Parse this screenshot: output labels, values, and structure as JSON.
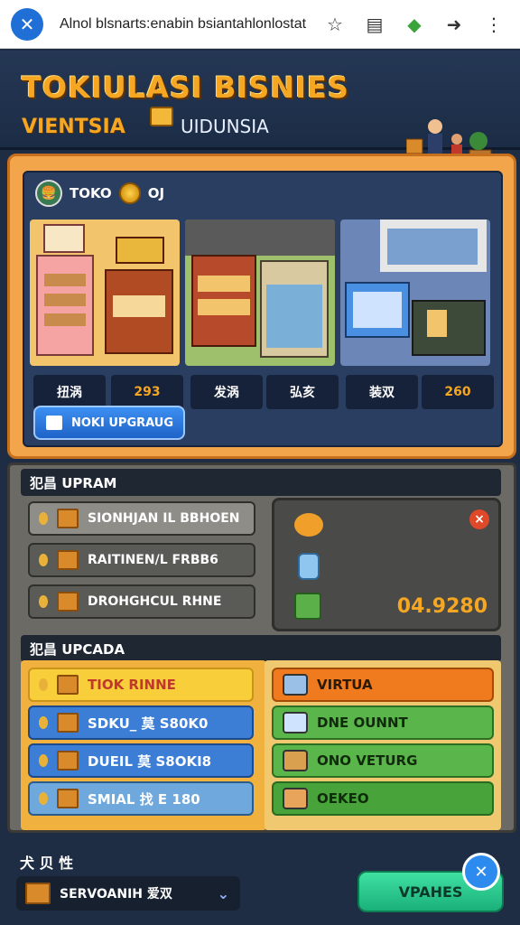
{
  "browser": {
    "url": "Alnol blsnarts:enabin bsiantahlonlostat",
    "site_icon": "kite-logo-icon",
    "icons": [
      "star-icon",
      "notes-icon",
      "extension-icon",
      "share-icon",
      "more-icon"
    ]
  },
  "header": {
    "title_line1": "TOKIULASI BISNIES",
    "title_line2": "VIENTSIA",
    "title_line3": "UIDUNSIA"
  },
  "shop": {
    "name": "TOKO",
    "count": "OJ",
    "stores": [
      {
        "label": "扭涡",
        "value": "293"
      },
      {
        "label": "",
        "value": ""
      },
      {
        "label": "",
        "value": ""
      }
    ],
    "labels": [
      "扭涡",
      "293",
      "发涡",
      "弘亥",
      "装双",
      "260"
    ],
    "upgrade_button": "NOKI UPGRAUG"
  },
  "upgrades": {
    "section1_title": "犯昌 UPRAM",
    "items": [
      "SIONHJAN IL BBHOEN",
      "RAITINEN/L FRBB6",
      "DROHGHCUL RHNE"
    ],
    "info_value": "04.9280",
    "section2_title": "犯昌 UPCADA",
    "left_buttons": [
      "TIOK RINNE",
      "SDKU_ 莫 S80K0",
      "DUEIL 莫 S8OKI8",
      "SMIAL 找 E 180"
    ],
    "right_buttons": [
      "VIRTUA",
      "DNE OUNNT",
      "ONO VETURG",
      "OEKEO"
    ]
  },
  "footer": {
    "label": "犬 贝 性",
    "dropdown": "SERVOANIH 爱双",
    "update_button": "VPAHES"
  },
  "colors": {
    "accent_orange": "#f5a623",
    "panel_blue": "#2a3e62",
    "update_green": "#1ab07a"
  }
}
